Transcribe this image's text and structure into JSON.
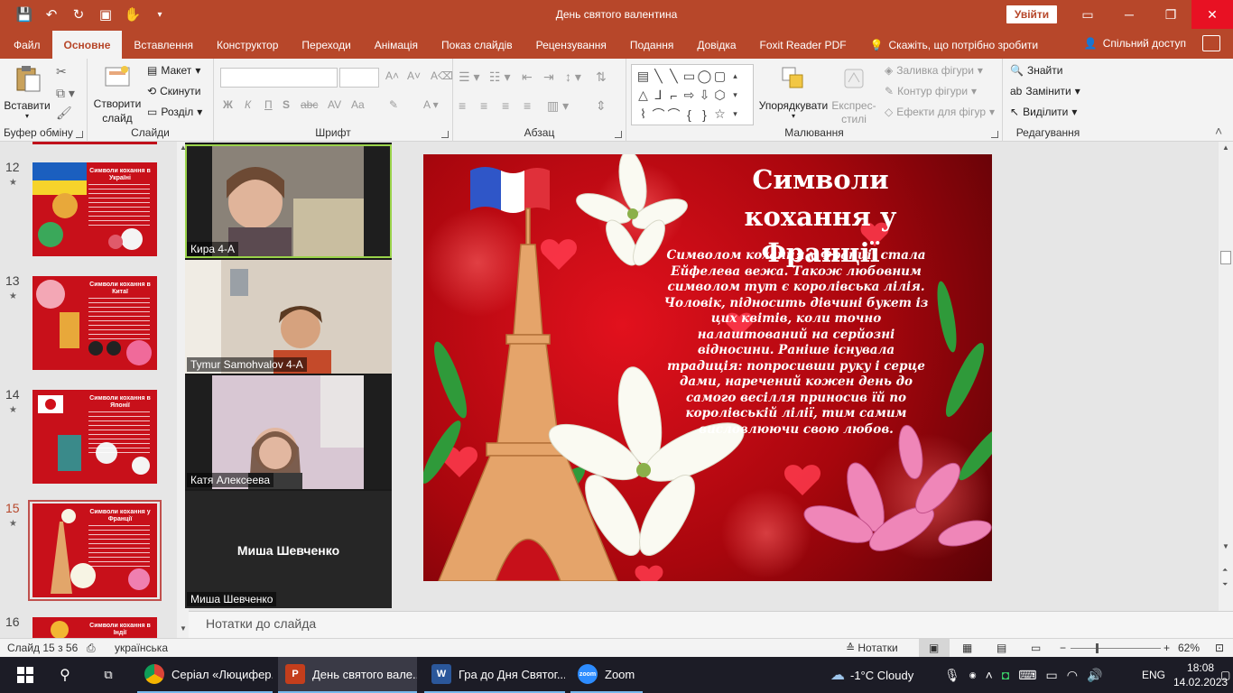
{
  "window": {
    "title": "День святого валентина",
    "signin_label": "Увійти",
    "minimize": "─",
    "restore": "❐",
    "close": "✕"
  },
  "tabs": [
    {
      "label": "Файл"
    },
    {
      "label": "Основне"
    },
    {
      "label": "Вставлення"
    },
    {
      "label": "Конструктор"
    },
    {
      "label": "Переходи"
    },
    {
      "label": "Анімація"
    },
    {
      "label": "Показ слайдів"
    },
    {
      "label": "Рецензування"
    },
    {
      "label": "Подання"
    },
    {
      "label": "Довідка"
    },
    {
      "label": "Foxit Reader PDF"
    }
  ],
  "tell_me": "Скажіть, що потрібно зробити",
  "share_label": "Спільний доступ",
  "ribbon": {
    "clipboard": {
      "paste": "Вставити",
      "label": "Буфер обміну"
    },
    "slides": {
      "new_slide": "Створити слайд",
      "layout": "Макет",
      "reset": "Скинути",
      "section": "Розділ",
      "label": "Слайди"
    },
    "font": {
      "bold": "Ж",
      "italic": "К",
      "underline": "П",
      "strike": "abc",
      "spacing": "AV",
      "case": "Aa",
      "label": "Шрифт"
    },
    "paragraph": {
      "label": "Абзац"
    },
    "drawing": {
      "arrange": "Упорядкувати",
      "quick_styles": "Експрес-стилі",
      "fill": "Заливка фігури",
      "outline": "Контур фігури",
      "effects": "Ефекти для фігур",
      "label": "Малювання"
    },
    "editing": {
      "find": "Знайти",
      "replace": "Замінити",
      "select": "Виділити",
      "label": "Редагування"
    }
  },
  "slides_panel": [
    {
      "num": "12",
      "title": "Символи кохання в Україні"
    },
    {
      "num": "13",
      "title": "Символи кохання в Китаї"
    },
    {
      "num": "14",
      "title": "Символи кохання в Японії"
    },
    {
      "num": "15",
      "title": "Символи кохання у Франції"
    },
    {
      "num": "16",
      "title": "Символи кохання в Індії"
    }
  ],
  "participants": [
    {
      "name": "Кира 4-А"
    },
    {
      "name": "Tymur Samohvalov 4-А"
    },
    {
      "name": "Катя Алексеева"
    },
    {
      "name": "Миша Шевченко",
      "display": "Миша Шевченко"
    }
  ],
  "slide": {
    "title": "Символи кохання у Франції",
    "body": "Символом кохання у Франції стала Ейфелева вежа. Також любовним символом тут є королівська лілія. Чоловік, підносить дівчині букет із цих квітів, коли точно налаштований на серйозні відносини. Раніше існувала традиція: попросивши руку і серце дами, наречений кожен день до самого весілля приносив їй по королівській лілії, тим самим висловлюючи свою любов."
  },
  "notes_placeholder": "Нотатки до слайда",
  "status": {
    "slide_count": "Слайд 15 з 56",
    "language": "українська",
    "notes_btn": "Нотатки",
    "zoom": "62%",
    "zoom_level": 0.62
  },
  "taskbar": {
    "apps": [
      {
        "label": "Серіал «Люцифер...",
        "icon": "chrome-icon"
      },
      {
        "label": "День святого вале...",
        "icon": "powerpoint-icon"
      },
      {
        "label": "Гра  до Дня Святог...",
        "icon": "word-icon"
      },
      {
        "label": "Zoom",
        "icon": "zoom-icon"
      }
    ],
    "weather": "-1°C  Cloudy",
    "lang": "ENG",
    "time": "18:08",
    "date": "14.02.2023"
  },
  "colors": {
    "accent": "#b7472a",
    "slide_red": "#d0101a",
    "active_speaker": "#9ad34a"
  }
}
